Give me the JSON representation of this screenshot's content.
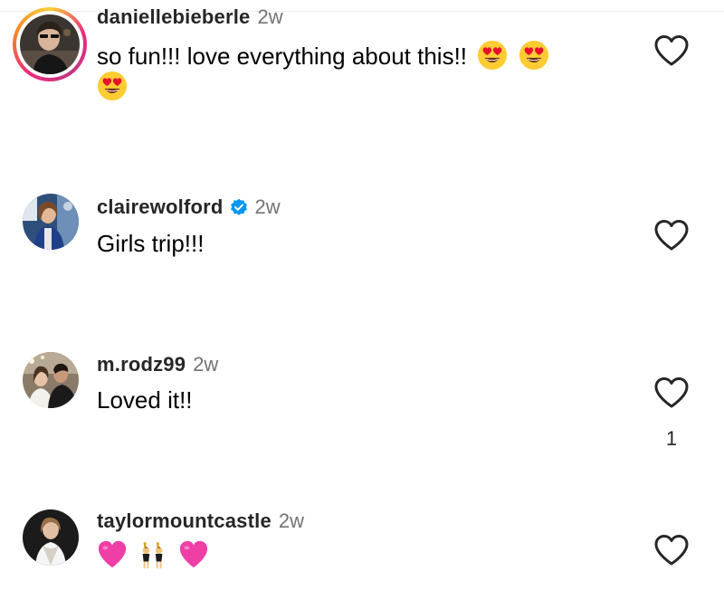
{
  "comments": [
    {
      "username": "daniellebieberle",
      "time": "2w",
      "text": "so fun!!! love everything about this!!",
      "emoji": [
        "heart-eyes-emoji",
        "heart-eyes-emoji",
        "heart-eyes-emoji"
      ],
      "has_story_ring": true,
      "verified": false,
      "likes": ""
    },
    {
      "username": "clairewolford",
      "time": "2w",
      "text": "Girls trip!!!",
      "emoji": [],
      "has_story_ring": false,
      "verified": true,
      "likes": ""
    },
    {
      "username": "m.rodz99",
      "time": "2w",
      "text": "Loved it!!",
      "emoji": [],
      "has_story_ring": false,
      "verified": false,
      "likes": "1"
    },
    {
      "username": "taylormountcastle",
      "time": "2w",
      "text": "",
      "emoji": [
        "pink-heart-emoji",
        "dancing-bunny-emoji",
        "pink-heart-emoji"
      ],
      "has_story_ring": false,
      "verified": false,
      "likes": ""
    }
  ],
  "colors": {
    "username": "#262626",
    "timestamp": "#737373",
    "verified": "#0095f6",
    "heart_outline": "#262626"
  }
}
